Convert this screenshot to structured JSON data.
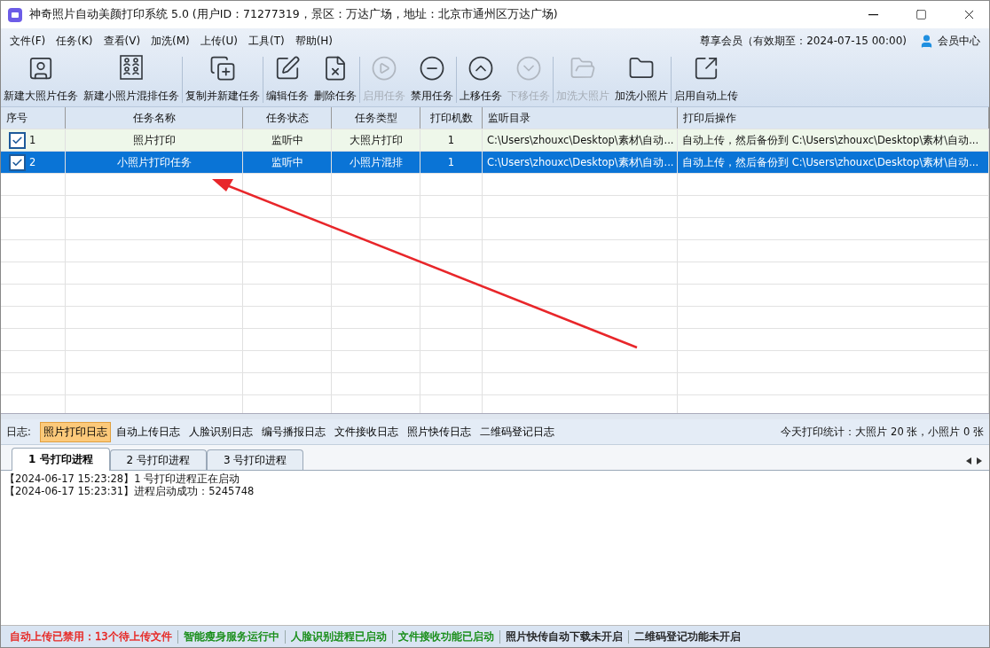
{
  "window": {
    "title": "神奇照片自动美颜打印系统 5.0 (用户ID：71277319，景区：万达广场，地址：北京市通州区万达广场)"
  },
  "menu": [
    "文件(F)",
    "任务(K)",
    "查看(V)",
    "加洗(M)",
    "上传(U)",
    "工具(T)",
    "帮助(H)"
  ],
  "membership": {
    "text": "尊享会员（有效期至：2024-07-15 00:00)",
    "link": "会员中心"
  },
  "toolbar": [
    [
      {
        "label": "新建大照片任务",
        "disabled": false
      },
      {
        "label": "新建小照片混排任务",
        "disabled": false
      }
    ],
    [
      {
        "label": "复制并新建任务",
        "disabled": false
      }
    ],
    [
      {
        "label": "编辑任务",
        "disabled": false
      },
      {
        "label": "删除任务",
        "disabled": false
      }
    ],
    [
      {
        "label": "启用任务",
        "disabled": true
      },
      {
        "label": "禁用任务",
        "disabled": false
      }
    ],
    [
      {
        "label": "上移任务",
        "disabled": false
      },
      {
        "label": "下移任务",
        "disabled": true
      }
    ],
    [
      {
        "label": "加洗大照片",
        "disabled": true
      },
      {
        "label": "加洗小照片",
        "disabled": false
      }
    ],
    [
      {
        "label": "启用自动上传",
        "disabled": false
      }
    ]
  ],
  "table": {
    "columns": [
      "序号",
      "任务名称",
      "任务状态",
      "任务类型",
      "打印机数",
      "监听目录",
      "打印后操作"
    ],
    "rows": [
      {
        "checked": true,
        "selected": false,
        "cells": [
          "1",
          "照片打印",
          "监听中",
          "大照片打印",
          "1",
          "C:\\Users\\zhouxc\\Desktop\\素材\\自动...",
          "自动上传，然后备份到 C:\\Users\\zhouxc\\Desktop\\素材\\自动..."
        ]
      },
      {
        "checked": true,
        "selected": true,
        "cells": [
          "2",
          "小照片打印任务",
          "监听中",
          "小照片混排",
          "1",
          "C:\\Users\\zhouxc\\Desktop\\素材\\自动...",
          "自动上传，然后备份到 C:\\Users\\zhouxc\\Desktop\\素材\\自动..."
        ]
      }
    ]
  },
  "log_bar": {
    "label": "日志:",
    "filters": [
      {
        "label": "照片打印日志",
        "selected": true
      },
      {
        "label": "自动上传日志",
        "selected": false
      },
      {
        "label": "人脸识别日志",
        "selected": false
      },
      {
        "label": "编号播报日志",
        "selected": false
      },
      {
        "label": "文件接收日志",
        "selected": false
      },
      {
        "label": "照片快传日志",
        "selected": false
      },
      {
        "label": "二维码登记日志",
        "selected": false
      }
    ],
    "stats": "今天打印统计：大照片 20 张，小照片 0 张"
  },
  "process_tabs": [
    {
      "label": "1 号打印进程",
      "selected": true
    },
    {
      "label": "2 号打印进程",
      "selected": false
    },
    {
      "label": "3 号打印进程",
      "selected": false
    }
  ],
  "log_lines": [
    "【2024-06-17 15:23:28】1 号打印进程正在启动",
    "【2024-06-17 15:23:31】进程启动成功：5245748"
  ],
  "status_bar": [
    {
      "text": "自动上传已禁用：13个待上传文件",
      "color": "#e8201c"
    },
    {
      "text": "智能瘦身服务运行中",
      "color": "#108a10"
    },
    {
      "text": "人脸识别进程已启动",
      "color": "#108a10"
    },
    {
      "text": "文件接收功能已启动",
      "color": "#108a10"
    },
    {
      "text": "照片快传自动下载未开启",
      "color": "#1a1a1a"
    },
    {
      "text": "二维码登记功能未开启",
      "color": "#1a1a1a"
    }
  ]
}
